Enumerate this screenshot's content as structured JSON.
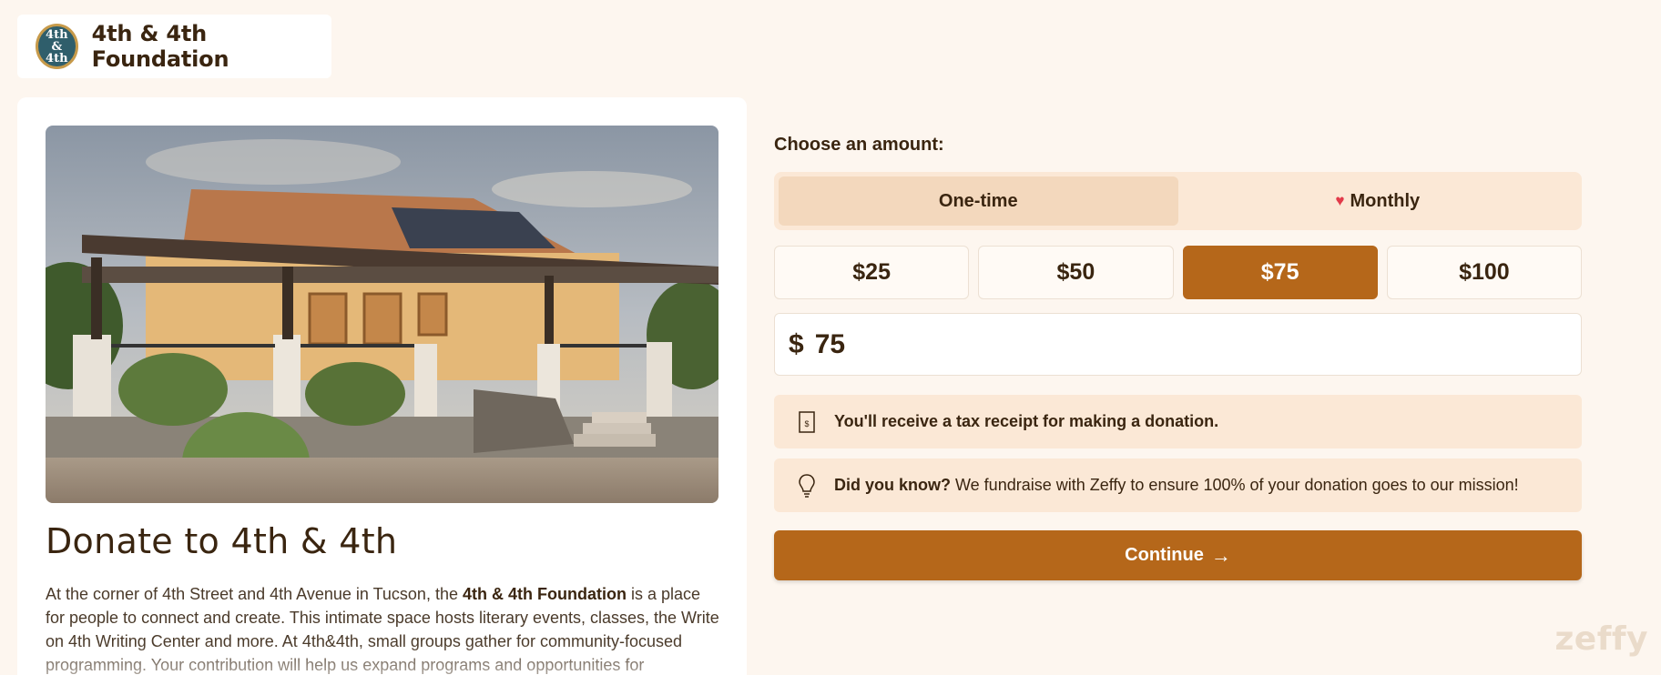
{
  "org": {
    "name": "4th & 4th Foundation",
    "logo_text": "4th & 4th"
  },
  "campaign": {
    "title": "Donate to 4th & 4th",
    "description_pre": "At the corner of 4th Street and 4th Avenue in Tucson, the ",
    "description_bold": "4th & 4th Foundation",
    "description_post": " is a place for people to connect and create. This intimate space hosts literary events, classes, the Write on 4th Writing Center and more. At 4th&4th, small groups gather for community-focused programming. Your contribution will help us expand programs and opportunities for"
  },
  "form": {
    "choose_label": "Choose an amount:",
    "frequency": {
      "one_time": "One-time",
      "monthly": "Monthly",
      "selected": "one_time"
    },
    "amounts": [
      "$25",
      "$50",
      "$75",
      "$100"
    ],
    "selected_amount": "$75",
    "currency_symbol": "$",
    "amount_value": "75",
    "tax_receipt_text": "You'll receive a tax receipt for making a donation.",
    "did_you_know_label": "Did you know?",
    "did_you_know_text": "We fundraise with Zeffy to ensure 100% of your donation goes to our mission!",
    "continue_label": "Continue"
  },
  "branding": {
    "watermark": "zeffy"
  },
  "colors": {
    "background": "#fdf6ef",
    "accent": "#b5671a",
    "toggle_bg": "#fbe8d6",
    "heart": "#e23a4a"
  },
  "icons": [
    "receipt-icon",
    "lightbulb-icon",
    "heart-icon",
    "arrow-right-icon"
  ]
}
